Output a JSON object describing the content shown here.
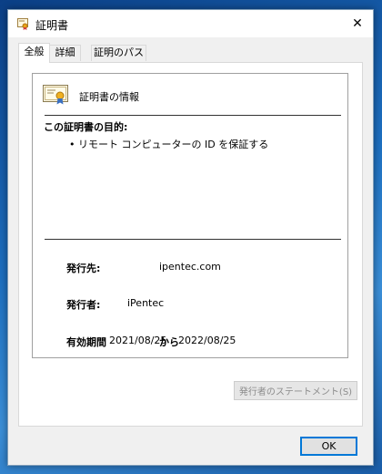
{
  "window": {
    "title": "証明書",
    "close_glyph": "✕"
  },
  "tabs": [
    {
      "label": "全般",
      "active": true
    },
    {
      "label": "詳細",
      "active": false
    },
    {
      "label": "証明のパス",
      "active": false
    }
  ],
  "general": {
    "heading": "証明書の情報",
    "purpose_title": "この証明書の目的:",
    "purposes": [
      "• リモート コンピューターの ID を保証する"
    ],
    "issued_to_label": "発行先:",
    "issued_to_value": "ipentec.com",
    "issued_by_label": "発行者:",
    "issued_by_value": "iPentec",
    "validity_label": "有効期間",
    "valid_from": "2021/08/25",
    "valid_to_word": "から",
    "valid_to": "2022/08/25",
    "statement_button": "発行者のステートメント(S)"
  },
  "buttons": {
    "ok": "OK"
  },
  "icons": {
    "title": "certificate-icon",
    "cert": "certificate-icon",
    "close": "close-icon"
  }
}
